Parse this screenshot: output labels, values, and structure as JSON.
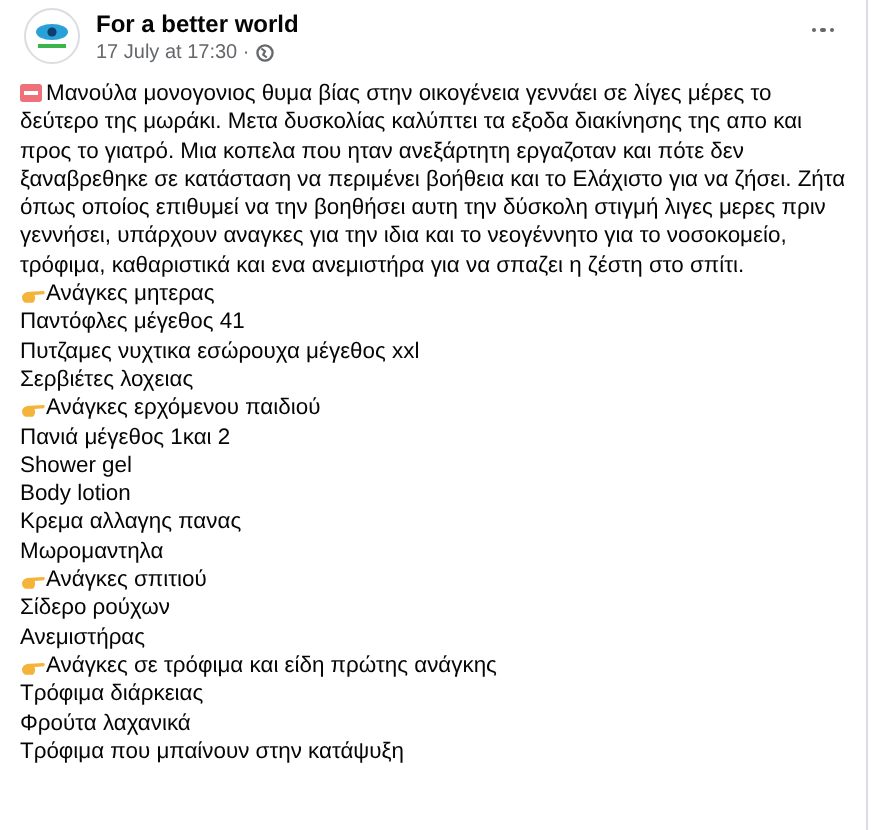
{
  "post": {
    "author": "For a better world",
    "time": "17 July at 17:30 ·",
    "text": "Μανούλα μονογονιος θυμα βίας στην οικογένεια γεννάει σε λίγες μέρες το δεύτερο της μωράκι. Μετα δυσκολίας καλύπτει τα εξοδα διακίνησης της απο και προς το γιατρό. Μια κοπελα που ηταν ανεξάρτητη εργαζοταν και πότε δεν ξαναβρεθηκε σε κατάσταση να περιμένει βοήθεια και το Ελάχιστο για να ζήσει. Ζήτα όπως οποίος επιθυμεί να την βοηθήσει αυτη την δύσκολη στιγμή λιγες μερες πριν γεννήσει, υπάρχουν αναγκες για την ιδια και το νεογέννητο για το νοσοκομείο, τρόφιμα, καθαριστικά και ενα ανεμιστήρα για να σπαζει η ζέστη στο σπίτι.",
    "lines": [
      {
        "kind": "heading",
        "text": "Ανάγκες μητερας"
      },
      {
        "kind": "item",
        "text": "Παντόφλες μέγεθος 41"
      },
      {
        "kind": "item",
        "text": "Πυτζαμες νυχτικα εσώρουχα μέγεθος xxl"
      },
      {
        "kind": "item",
        "text": "Σερβιέτες λοχειας"
      },
      {
        "kind": "heading",
        "text": "Ανάγκες ερχόμενου παιδιού"
      },
      {
        "kind": "item",
        "text": "Πανιά μέγεθος 1και 2"
      },
      {
        "kind": "item",
        "text": "Shower gel"
      },
      {
        "kind": "item",
        "text": "Body lotion"
      },
      {
        "kind": "item",
        "text": "Κρεμα αλλαγης πανας"
      },
      {
        "kind": "item",
        "text": "Μωρομαντηλα"
      },
      {
        "kind": "heading",
        "text": "Ανάγκες σπιτιού"
      },
      {
        "kind": "item",
        "text": "Σίδερο ρούχων"
      },
      {
        "kind": "item",
        "text": "Ανεμιστήρας"
      },
      {
        "kind": "heading",
        "text": "Ανάγκες σε τρόφιμα και είδη πρώτης ανάγκης"
      },
      {
        "kind": "item",
        "text": "Τρόφιμα διάρκειας"
      },
      {
        "kind": "item",
        "text": "Φρούτα λαχανικά"
      },
      {
        "kind": "item",
        "text": "Τρόφιμα που μπαίνουν στην κατάψυξη"
      }
    ]
  }
}
